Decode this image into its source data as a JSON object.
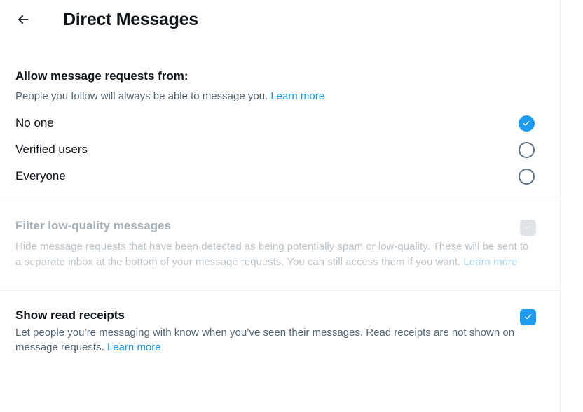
{
  "header": {
    "back_icon": "arrow-left-icon",
    "title": "Direct Messages"
  },
  "allow_requests": {
    "heading": "Allow message requests from:",
    "description": "People you follow will always be able to message you. ",
    "learn_more": "Learn more",
    "options": [
      {
        "label": "No one",
        "selected": true
      },
      {
        "label": "Verified users",
        "selected": false
      },
      {
        "label": "Everyone",
        "selected": false
      }
    ]
  },
  "filter_low_quality": {
    "heading": "Filter low-quality messages",
    "description": "Hide message requests that have been detected as being potentially spam or low-quality. These will be sent to a separate inbox at the bottom of your message requests. You can still access them if you want. ",
    "learn_more": "Learn more",
    "checked": true,
    "disabled": true
  },
  "read_receipts": {
    "heading": "Show read receipts",
    "description": "Let people you’re messaging with know when you’ve seen their messages. Read receipts are not shown on message requests. ",
    "learn_more": "Learn more",
    "checked": true,
    "disabled": false
  },
  "colors": {
    "accent": "#1d9bf0",
    "text_primary": "#0f1419",
    "text_secondary": "#536471",
    "divider": "#eff3f4",
    "disabled_fill": "#dfe3e5",
    "radio_border": "#5b7083"
  }
}
